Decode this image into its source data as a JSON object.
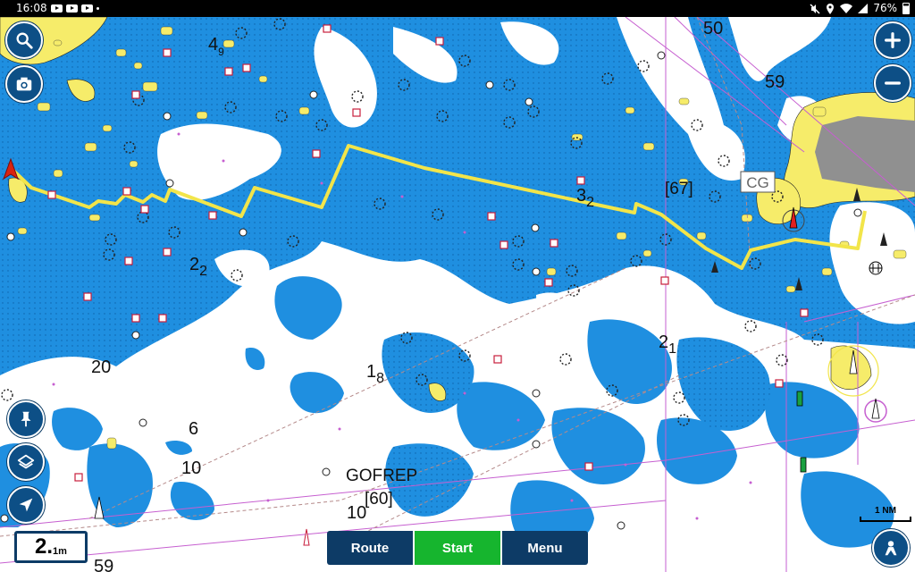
{
  "status_bar": {
    "time": "16:08",
    "icons": [
      "youtube-icon",
      "youtube-icon",
      "youtube-icon",
      "dot-icon",
      "mute-icon",
      "location-icon",
      "wifi-icon",
      "signal-icon"
    ],
    "battery": "76%"
  },
  "map": {
    "depth_labels": [
      {
        "main": "4",
        "sub": "9"
      },
      {
        "main": "50",
        "sub": ""
      },
      {
        "main": "59",
        "sub": ""
      },
      {
        "main": "3",
        "sub": "2"
      },
      {
        "main": "[67]",
        "sub": ""
      },
      {
        "main": "2",
        "sub": "2"
      },
      {
        "main": "2",
        "sub": "1"
      },
      {
        "main": "20",
        "sub": ""
      },
      {
        "main": "1",
        "sub": "8"
      },
      {
        "main": "6",
        "sub": ""
      },
      {
        "main": "10",
        "sub": ""
      },
      {
        "main": "GOFREP",
        "sub": ""
      },
      {
        "main": "[60]",
        "sub": ""
      },
      {
        "main": "10",
        "sub": ""
      },
      {
        "main": "59",
        "sub": ""
      }
    ],
    "cg_label": "CG",
    "colors": {
      "water": "#1f8fe0",
      "shallow": "#ffffff",
      "land": "#f6ec6a",
      "urban": "#909090",
      "route": "#f2e54a",
      "track": "#c65fd0"
    }
  },
  "controls": {
    "search_icon": "search-icon",
    "camera_icon": "camera-icon",
    "zoom_in_icon": "plus-icon",
    "zoom_out_icon": "minus-icon",
    "pin_icon": "pin-icon",
    "layers_icon": "layers-icon",
    "locate_icon": "navigation-arrow-icon",
    "profile_icon": "person-icon"
  },
  "depth_box": {
    "value": "2.",
    "decimal": "1",
    "unit": "m"
  },
  "nav": {
    "route_label": "Route",
    "start_label": "Start",
    "menu_label": "Menu"
  },
  "scale": {
    "label": "1 NM"
  }
}
